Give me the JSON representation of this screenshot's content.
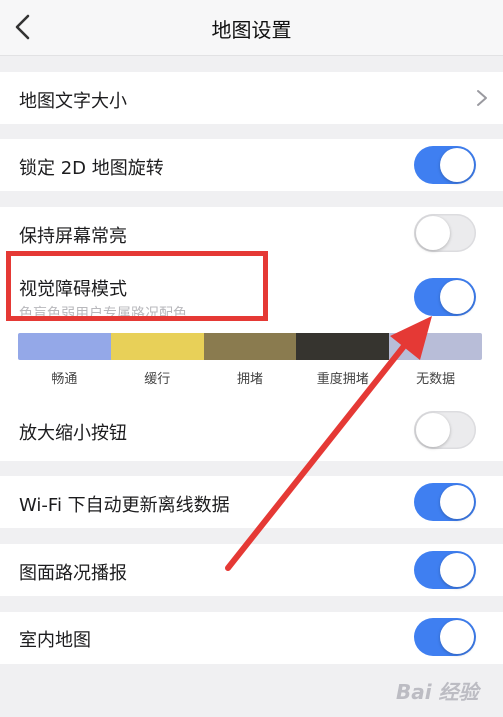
{
  "header": {
    "title": "地图设置",
    "back_icon": "chevron-left-icon"
  },
  "settings": {
    "text_size": {
      "label": "地图文字大小",
      "icon": "chevron-right-icon"
    },
    "lock_2d_rotation": {
      "label": "锁定 2D 地图旋转",
      "enabled": true
    },
    "keep_screen_on": {
      "label": "保持屏幕常亮",
      "enabled": false
    },
    "color_blind_mode": {
      "label": "视觉障碍模式",
      "subtitle": "色盲色弱用户专属路况配色",
      "enabled": true
    },
    "zoom_buttons": {
      "label": "放大缩小按钮",
      "enabled": false
    },
    "wifi_offline_update": {
      "label": "Wi-Fi 下自动更新离线数据",
      "enabled": true
    },
    "traffic_broadcast": {
      "label": "图面路况播报",
      "enabled": true
    },
    "indoor_map": {
      "label": "室内地图",
      "enabled": true
    }
  },
  "traffic_legend": [
    {
      "label": "畅通",
      "color": "#94a8e8"
    },
    {
      "label": "缓行",
      "color": "#e8d058"
    },
    {
      "label": "拥堵",
      "color": "#8a7b4f"
    },
    {
      "label": "重度拥堵",
      "color": "#36342f"
    },
    {
      "label": "无数据",
      "color": "#b8bdd8"
    }
  ],
  "colors": {
    "accent": "#3f7ff1",
    "annotation": "#e53935"
  },
  "watermark": {
    "text": "Bai 经验"
  }
}
